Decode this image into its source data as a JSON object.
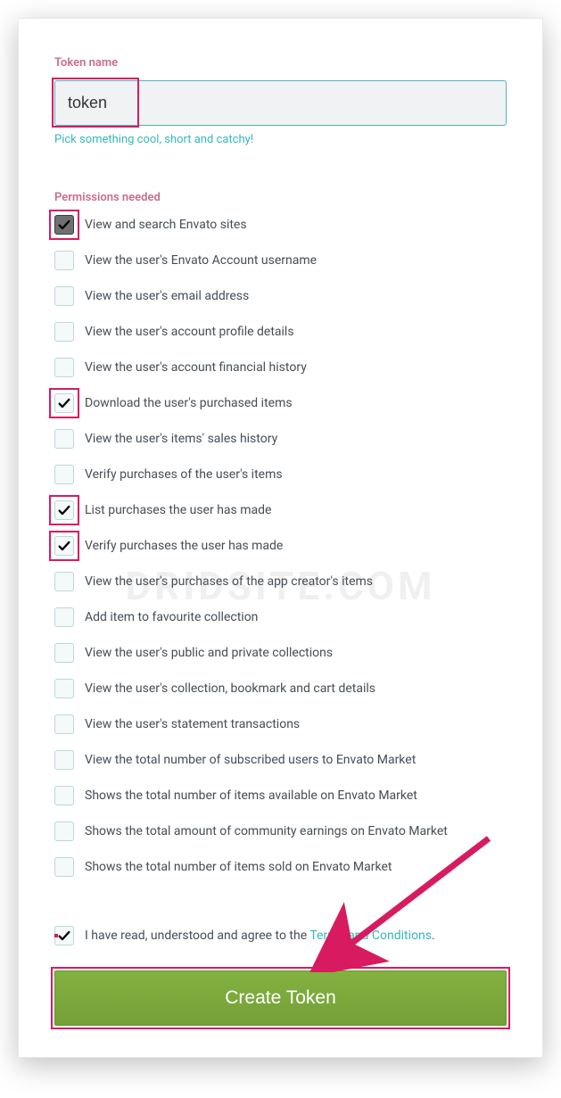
{
  "token": {
    "label": "Token name",
    "value": "token",
    "hint": "Pick something cool, short and catchy!"
  },
  "permissions": {
    "label": "Permissions needed",
    "items": [
      {
        "label": "View and search Envato sites",
        "checked": true,
        "highlighted": true,
        "dark": true
      },
      {
        "label": "View the user's Envato Account username",
        "checked": false,
        "highlighted": false,
        "dark": false
      },
      {
        "label": "View the user's email address",
        "checked": false,
        "highlighted": false,
        "dark": false
      },
      {
        "label": "View the user's account profile details",
        "checked": false,
        "highlighted": false,
        "dark": false
      },
      {
        "label": "View the user's account financial history",
        "checked": false,
        "highlighted": false,
        "dark": false
      },
      {
        "label": "Download the user's purchased items",
        "checked": true,
        "highlighted": true,
        "dark": false
      },
      {
        "label": "View the user's items' sales history",
        "checked": false,
        "highlighted": false,
        "dark": false
      },
      {
        "label": "Verify purchases of the user's items",
        "checked": false,
        "highlighted": false,
        "dark": false
      },
      {
        "label": "List purchases the user has made",
        "checked": true,
        "highlighted": true,
        "dark": false
      },
      {
        "label": "Verify purchases the user has made",
        "checked": true,
        "highlighted": true,
        "dark": false
      },
      {
        "label": "View the user's purchases of the app creator's items",
        "checked": false,
        "highlighted": false,
        "dark": false
      },
      {
        "label": "Add item to favourite collection",
        "checked": false,
        "highlighted": false,
        "dark": false
      },
      {
        "label": "View the user's public and private collections",
        "checked": false,
        "highlighted": false,
        "dark": false
      },
      {
        "label": "View the user's collection, bookmark and cart details",
        "checked": false,
        "highlighted": false,
        "dark": false
      },
      {
        "label": "View the user's statement transactions",
        "checked": false,
        "highlighted": false,
        "dark": false
      },
      {
        "label": "View the total number of subscribed users to Envato Market",
        "checked": false,
        "highlighted": false,
        "dark": false
      },
      {
        "label": "Shows the total number of items available on Envato Market",
        "checked": false,
        "highlighted": false,
        "dark": false
      },
      {
        "label": "Shows the total amount of community earnings on Envato Market",
        "checked": false,
        "highlighted": false,
        "dark": false
      },
      {
        "label": "Shows the total number of items sold on Envato Market",
        "checked": false,
        "highlighted": false,
        "dark": false
      }
    ]
  },
  "terms": {
    "checked": true,
    "highlighted": true,
    "prefix": "I have read, understood and agree to the ",
    "link_text": "Terms and Conditions",
    "suffix": "."
  },
  "create_button": "Create Token",
  "watermark": "DRIDSITE.COM",
  "annotation": {
    "highlight_color": "#d81b60",
    "arrow_color": "#d81b60"
  }
}
